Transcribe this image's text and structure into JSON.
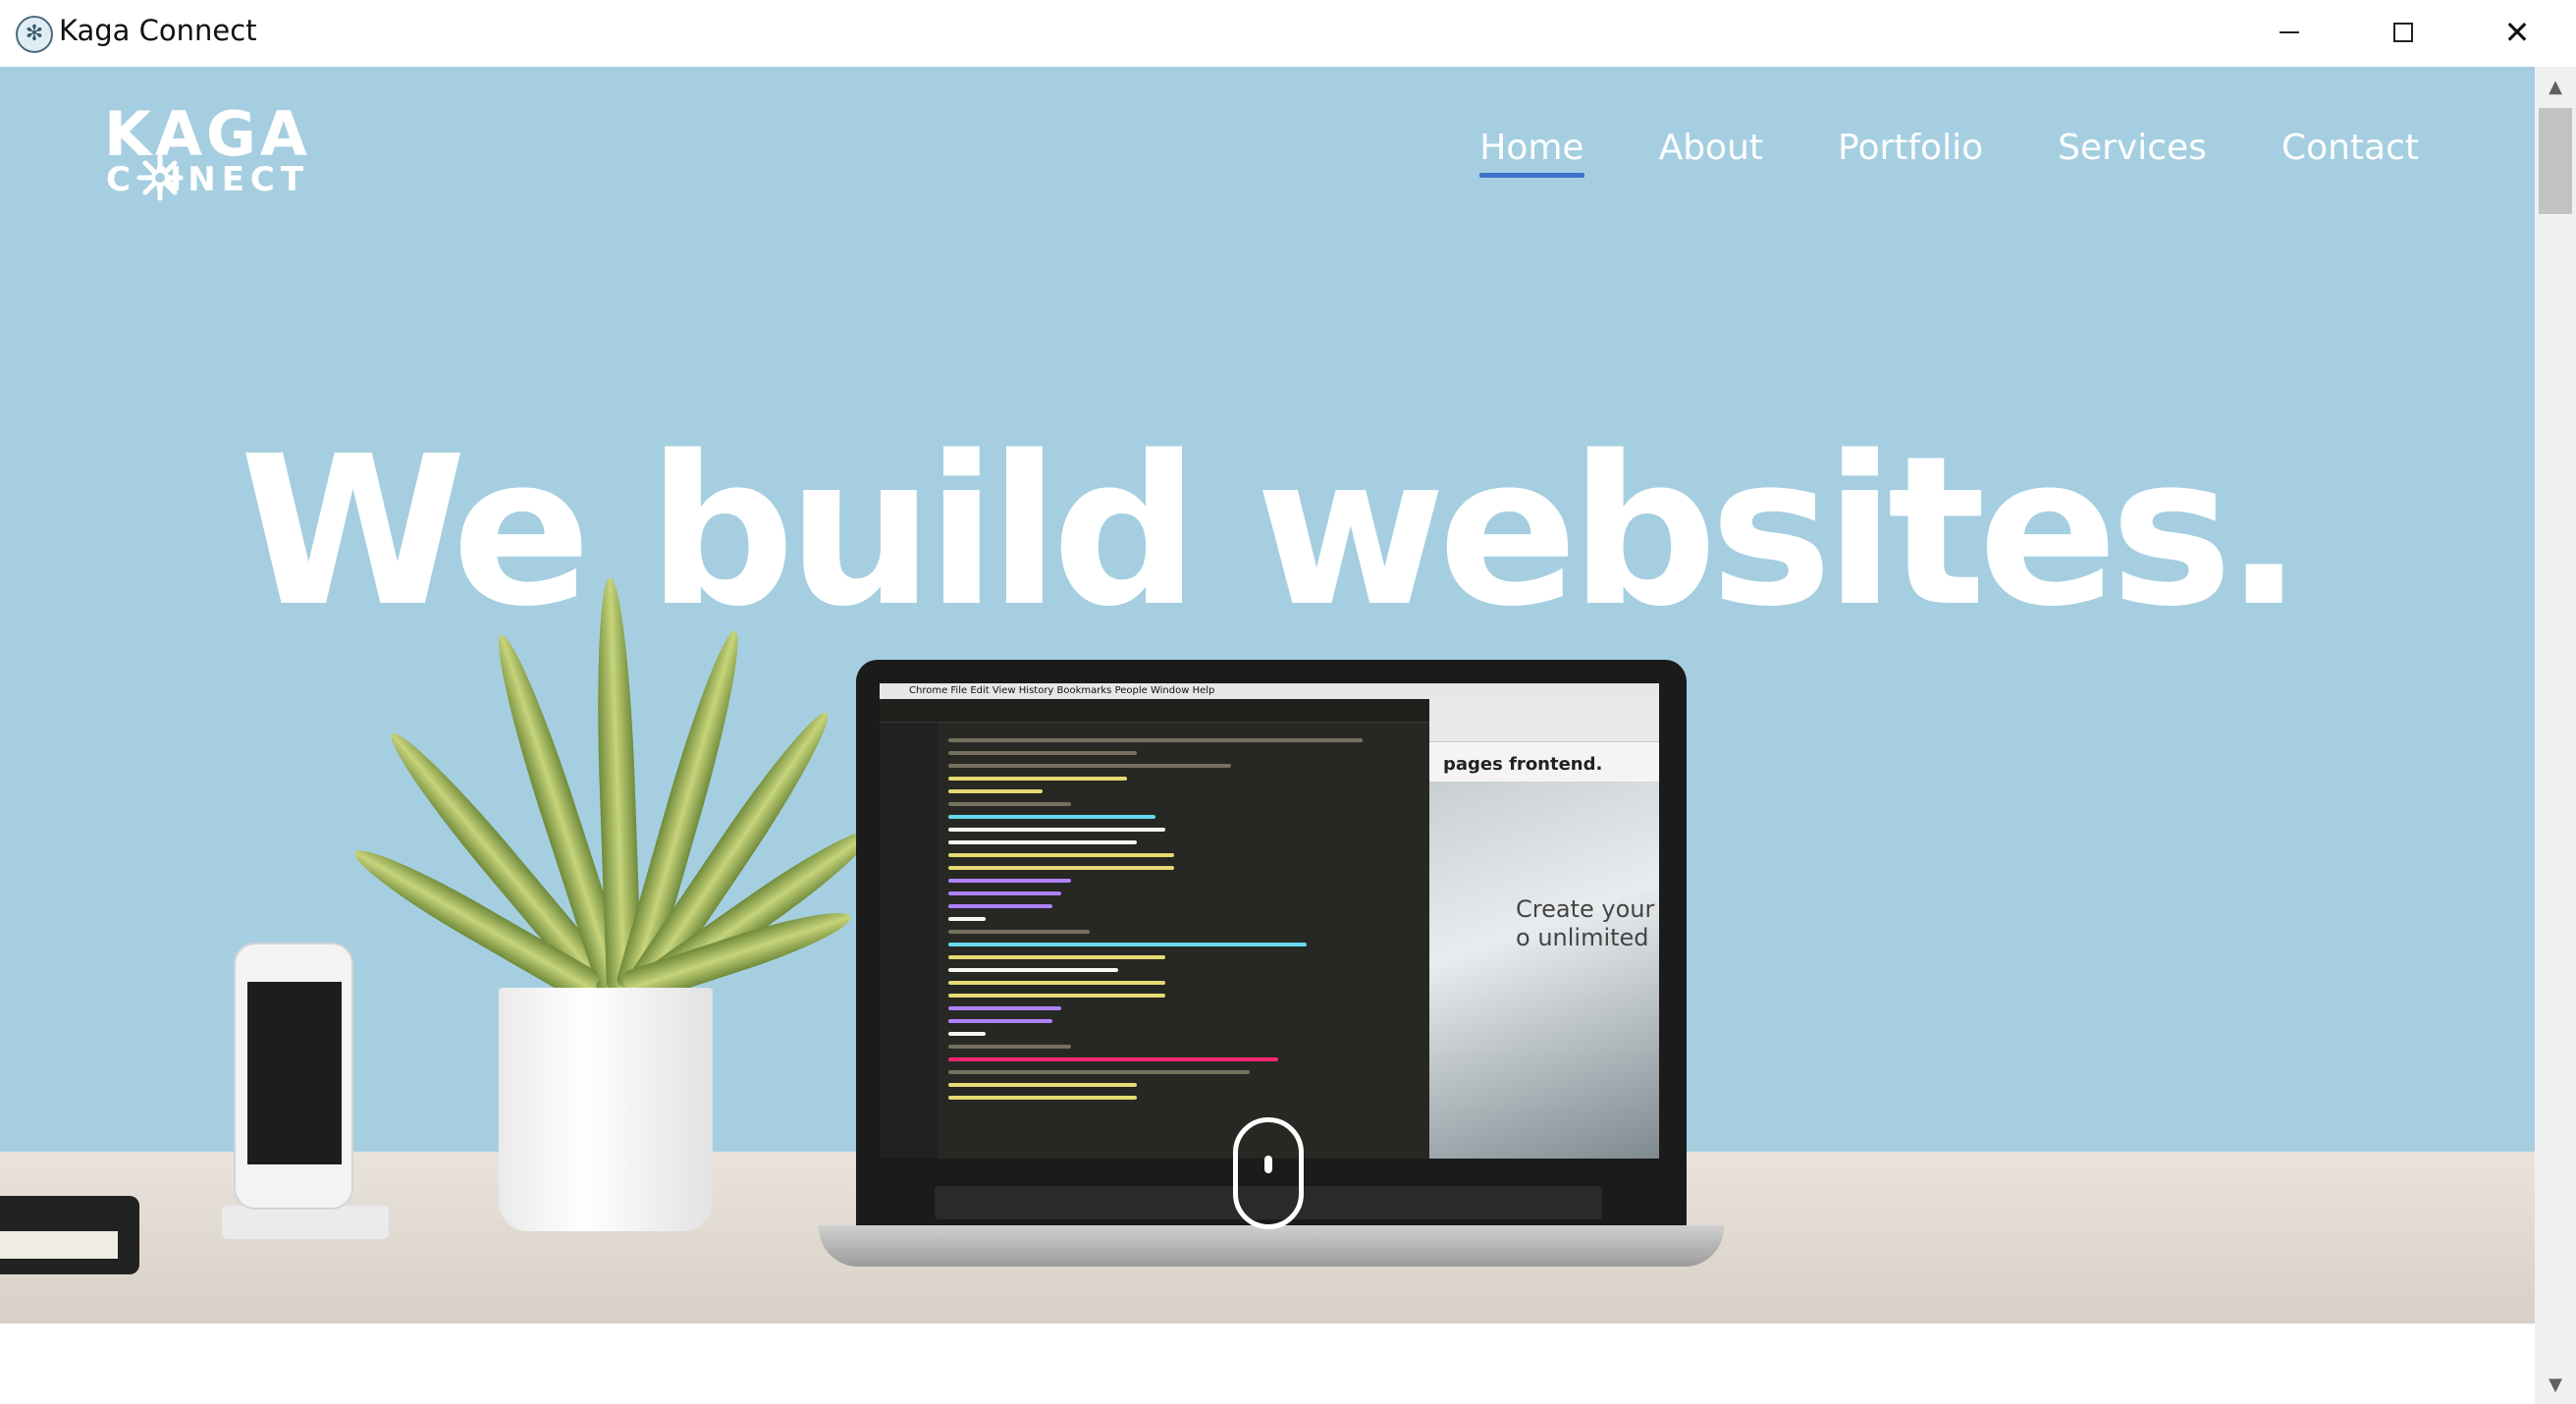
{
  "window": {
    "title": "Kaga Connect",
    "minimize_glyph": "",
    "maximize_glyph": "",
    "close_glyph": "✕"
  },
  "site": {
    "logo_line1": "KAGA",
    "logo_line2": "C NNECT",
    "nav": [
      {
        "label": "Home",
        "active": true
      },
      {
        "label": "About",
        "active": false
      },
      {
        "label": "Portfolio",
        "active": false
      },
      {
        "label": "Services",
        "active": false
      },
      {
        "label": "Contact",
        "active": false
      }
    ],
    "headline": "We build websites.",
    "screen": {
      "menubar": "Chrome   File   Edit   View   History   Bookmarks   People   Window   Help",
      "browser_brand": "pages frontend.",
      "browser_text": "Create your o unlimited"
    }
  },
  "colors": {
    "hero_background": "#a5cfe0",
    "nav_active_underline": "#3d72c8",
    "text_on_hero": "#ffffff"
  },
  "icons": {
    "app": "kaga-snowflake-icon",
    "scroll": "mouse-scroll-icon"
  },
  "scrollbar": {
    "up_arrow": "▲",
    "down_arrow": "▼"
  }
}
